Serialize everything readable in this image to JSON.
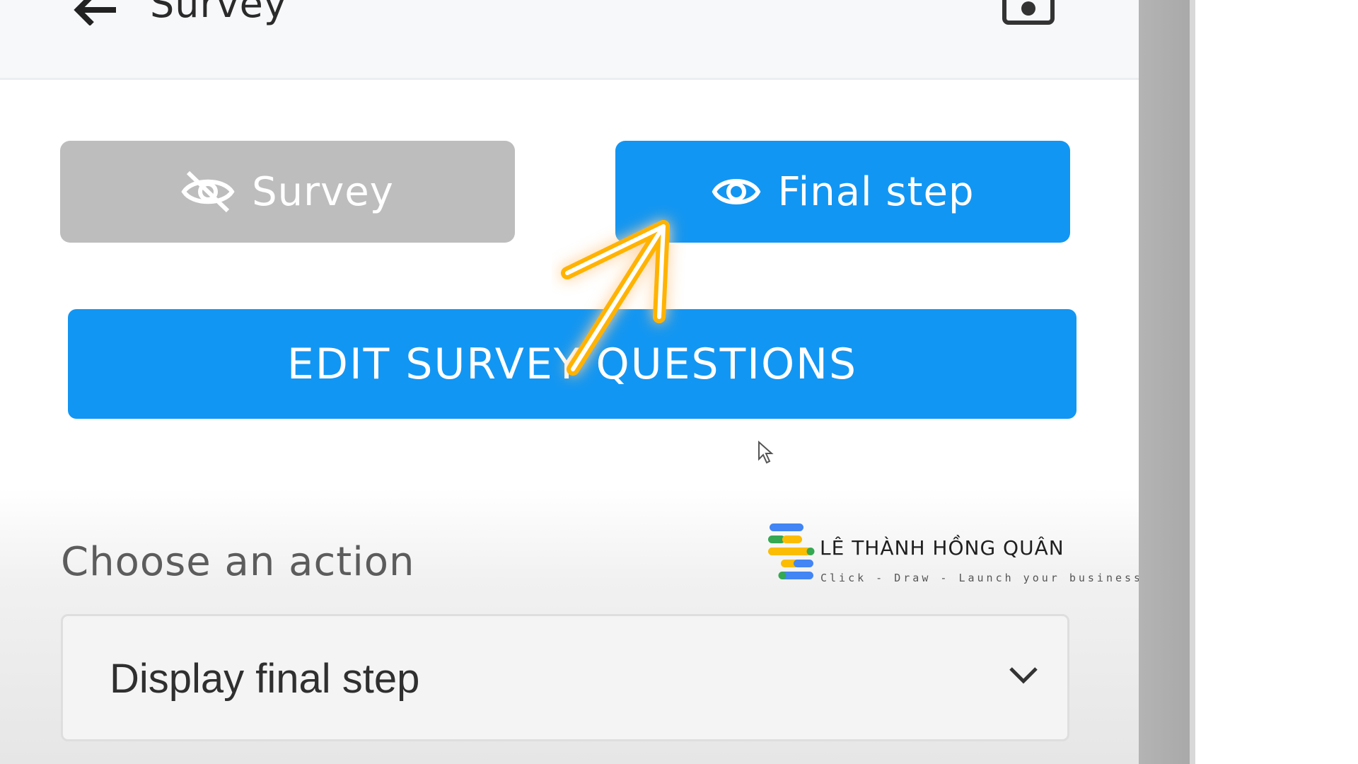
{
  "header": {
    "title": "Survey",
    "back_icon": "arrow-left-icon",
    "camera_icon": "camera-icon"
  },
  "toggles": {
    "survey_label": "Survey",
    "survey_icon": "eye-off-icon",
    "final_label": "Final step",
    "final_icon": "eye-icon"
  },
  "edit_button": {
    "label": "EDIT SURVEY QUESTIONS"
  },
  "action": {
    "label": "Choose an action",
    "selected": "Display final step"
  },
  "watermark": {
    "name": "LÊ THÀNH HỒNG QUÂN",
    "tagline": "Click - Draw - Launch your business"
  },
  "colors": {
    "primary": "#1296f3",
    "inactive": "#bdbdbd",
    "annotation_arrow": "#ffb300"
  }
}
